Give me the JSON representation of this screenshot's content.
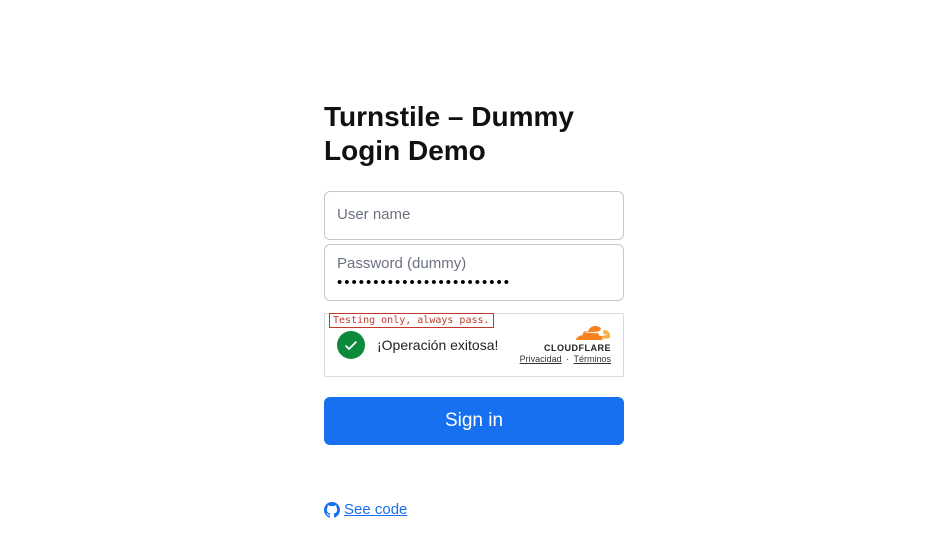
{
  "title": "Turnstile – Dummy Login Demo",
  "form": {
    "username_label": "User name",
    "username_value": "",
    "password_label": "Password (dummy)",
    "password_value": "testpassword-such-secure"
  },
  "turnstile": {
    "testing_badge": "Testing only, always pass.",
    "success_text": "¡Operación exitosa!",
    "brand": "CLOUDFLARE",
    "privacy": "Privacidad",
    "terms": "Términos",
    "separator": "·"
  },
  "actions": {
    "signin_label": "Sign in",
    "seecode_label": " See code"
  }
}
